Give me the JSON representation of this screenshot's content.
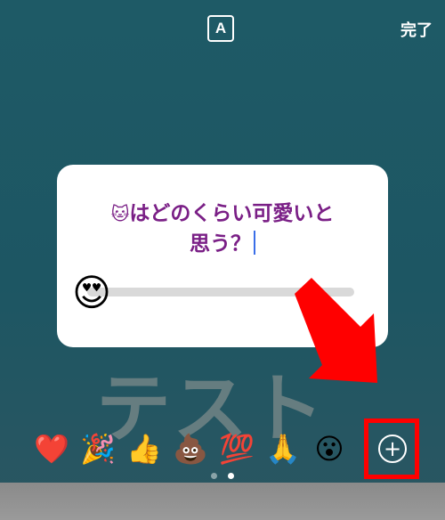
{
  "topbar": {
    "text_style_label": "A",
    "done_label": "完了"
  },
  "background_text": "テスト",
  "slider_card": {
    "question_emoji": "🐱",
    "question_text": "はどのくらい可愛いと思う？",
    "thumb_emoji": "😍",
    "value_fraction": 0.05
  },
  "emoji_bar": {
    "items": [
      {
        "emoji": "❤️",
        "icon": "heart-emoji"
      },
      {
        "emoji": "🎉",
        "icon": "party-popper-emoji"
      },
      {
        "emoji": "👍",
        "icon": "thumbs-up-emoji"
      },
      {
        "emoji": "💩",
        "icon": "pile-of-poo-emoji"
      },
      {
        "emoji": "💯",
        "icon": "hundred-points-emoji"
      },
      {
        "emoji": "🙏",
        "icon": "folded-hands-emoji"
      },
      {
        "emoji": "😮",
        "icon": "surprised-face-emoji"
      }
    ],
    "add_icon": "plus-circle-icon"
  },
  "pager": {
    "pages": 2,
    "active_index": 1
  },
  "annotation": {
    "color": "#ff0000",
    "arrow": "red-arrow",
    "box": "red-highlight-box"
  }
}
